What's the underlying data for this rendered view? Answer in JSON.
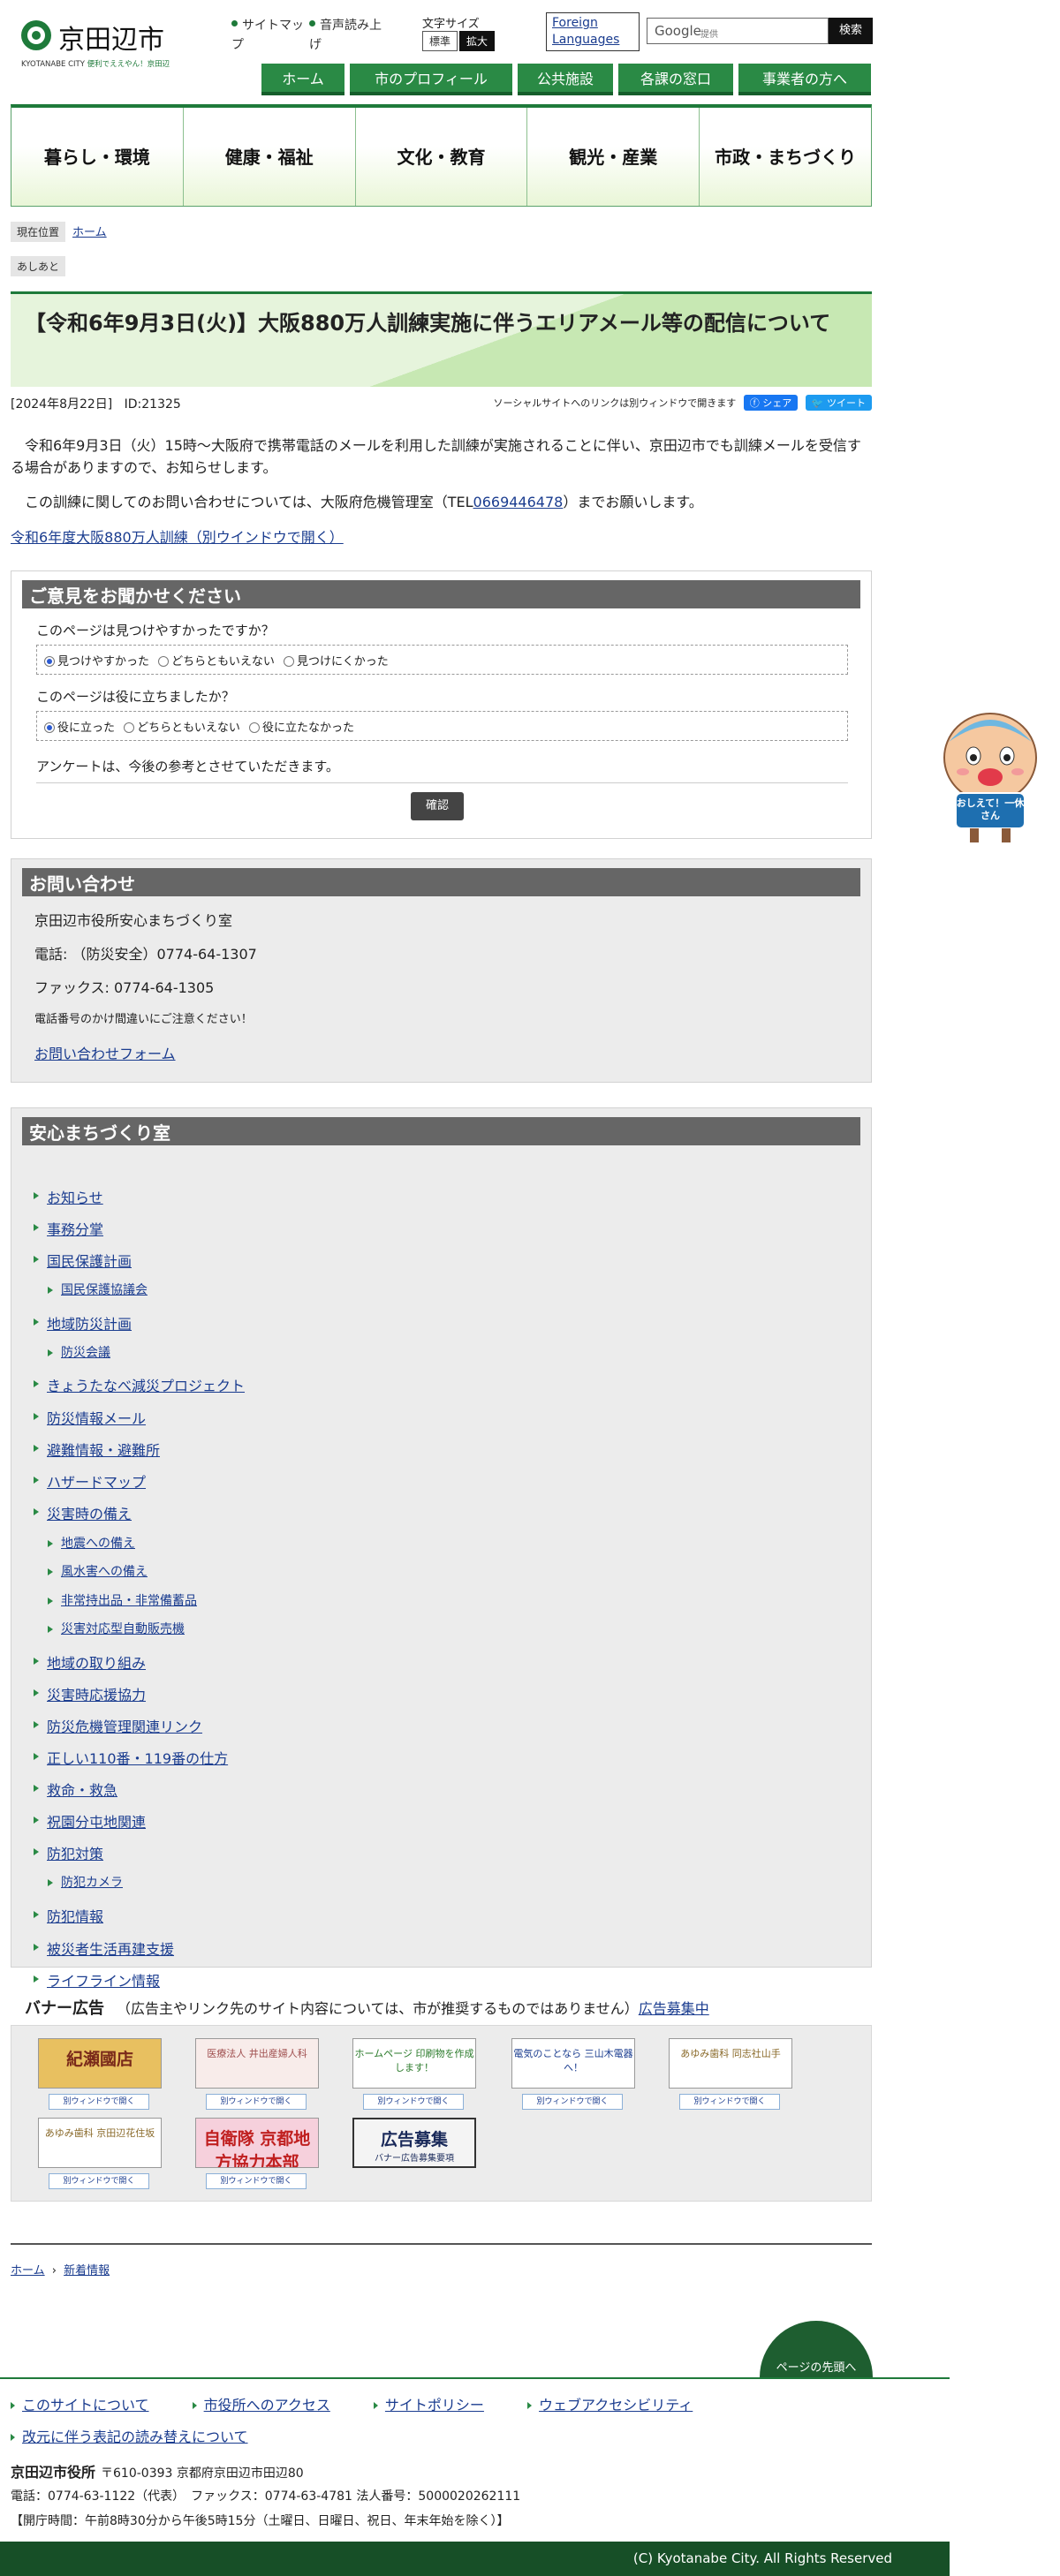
{
  "header": {
    "logo_name": "京田辺市",
    "logo_sub_city": "KYOTANABE CITY",
    "logo_sub_tagline": "便利でええやん！京田辺",
    "sitemap": "サイトマップ",
    "voice": "音声読み上げ",
    "fontsize_label": "文字サイズ",
    "fontsize_std": "標準",
    "fontsize_big": "拡大",
    "foreign": "Foreign Languages",
    "search_brand": "Google",
    "search_provided": "提供",
    "search_button": "検索",
    "subnav": [
      "ホーム",
      "市のプロフィール",
      "公共施設",
      "各課の窓口",
      "事業者の方へ"
    ]
  },
  "gnav": [
    "暮らし・環境",
    "健康・福祉",
    "文化・教育",
    "観光・産業",
    "市政・まちづくり"
  ],
  "breadcrumb": {
    "current_label": "現在位置",
    "home": "ホーム",
    "footprint_label": "あしあと"
  },
  "article": {
    "title": "【令和6年9月3日(火)】大阪880万人訓練実施に伴うエリアメール等の配信について",
    "date": "[2024年8月22日]",
    "id": "ID:21325",
    "social_note": "ソーシャルサイトへのリンクは別ウィンドウで開きます",
    "share": "シェア",
    "tweet": "ツイート",
    "para1": "令和6年9月3日（火）15時～大阪府で携帯電話のメールを利用した訓練が実施されることに伴い、京田辺市でも訓練メールを受信する場合がありますので、お知らせします。",
    "para2_before": "この訓練に関してのお問い合わせについては、大阪府危機管理室（TEL",
    "para2_tel": "0669446478",
    "para2_after": "）までお願いします。",
    "link": "令和6年度大阪880万人訓練（別ウインドウで開く）"
  },
  "survey": {
    "title": "ご意見をお聞かせください",
    "q1": "このページは見つけやすかったですか？",
    "q1_options": [
      "見つけやすかった",
      "どちらともいえない",
      "見つけにくかった"
    ],
    "q2": "このページは役に立ちましたか？",
    "q2_options": [
      "役に立った",
      "どちらともいえない",
      "役に立たなかった"
    ],
    "note": "アンケートは、今後の参考とさせていただきます。",
    "confirm": "確認"
  },
  "contact": {
    "title": "お問い合わせ",
    "dept": "京田辺市役所安心まちづくり室",
    "tel": "電話: （防災安全）0774-64-1307",
    "fax": "ファックス: 0774-64-1305",
    "warning": "電話番号のかけ間違いにご注意ください！",
    "form": "お問い合わせフォーム"
  },
  "section_menu": {
    "title": "安心まちづくり室",
    "items": [
      {
        "label": "お知らせ",
        "sub": false
      },
      {
        "label": "事務分掌",
        "sub": false
      },
      {
        "label": "国民保護計画",
        "sub": false
      },
      {
        "label": "国民保護協議会",
        "sub": true
      },
      {
        "label": "地域防災計画",
        "sub": false
      },
      {
        "label": "防災会議",
        "sub": true
      },
      {
        "label": "きょうたなべ減災プロジェクト",
        "sub": false
      },
      {
        "label": "防災情報メール",
        "sub": false
      },
      {
        "label": "避難情報・避難所",
        "sub": false
      },
      {
        "label": "ハザードマップ",
        "sub": false
      },
      {
        "label": "災害時の備え",
        "sub": false
      },
      {
        "label": "地震への備え",
        "sub": true
      },
      {
        "label": "風水害への備え",
        "sub": true
      },
      {
        "label": "非常持出品・非常備蓄品",
        "sub": true
      },
      {
        "label": "災害対応型自動販売機",
        "sub": true
      },
      {
        "label": "地域の取り組み",
        "sub": false
      },
      {
        "label": "災害時応援協力",
        "sub": false
      },
      {
        "label": "防災危機管理関連リンク",
        "sub": false
      },
      {
        "label": "正しい110番・119番の仕方",
        "sub": false
      },
      {
        "label": "救命・救急",
        "sub": false
      },
      {
        "label": "祝園分屯地関連",
        "sub": false
      },
      {
        "label": "防犯対策",
        "sub": false
      },
      {
        "label": "防犯カメラ",
        "sub": true
      },
      {
        "label": "防犯情報",
        "sub": false
      },
      {
        "label": "被災者生活再建支援",
        "sub": false
      },
      {
        "label": "ライフライン情報",
        "sub": false
      }
    ]
  },
  "banners": {
    "title": "バナー広告",
    "note": "（広告主やリンク先のサイト内容については、市が推奨するものではありません）",
    "recruit": "広告募集中",
    "new_window": "別ウィンドウで開く",
    "items": [
      {
        "text": "紀瀬國店",
        "color": "#7a2a1a",
        "bg": "#e8c060"
      },
      {
        "text": "医療法人 井出産婦人科",
        "color": "#a05050",
        "bg": "#f8ecea"
      },
      {
        "text": "ホームページ 印刷物を作成します！",
        "color": "#2a7a2a",
        "bg": "#ffffff"
      },
      {
        "text": "電気のことなら 三山木電器へ！",
        "color": "#1a3c8f",
        "bg": "#ffffff"
      },
      {
        "text": "あゆみ歯科 同志社山手",
        "color": "#8a6a2a",
        "bg": "#ffffff"
      },
      {
        "text": "あゆみ歯科 京田辺花住坂",
        "color": "#8a6a2a",
        "bg": "#ffffff"
      },
      {
        "text": "自衛隊 京都地方協力本部",
        "color": "#c02020",
        "bg": "#f6d0dc"
      },
      {
        "text": "広告募集",
        "color": "#1a2a5a",
        "bg": "#f4f4f4"
      }
    ],
    "recruit_sub": "バナー広告募集要項"
  },
  "bottom_crumb": {
    "home": "ホーム",
    "news": "新着情報"
  },
  "footer": {
    "pagetop": "ページの先頭へ",
    "links": [
      "このサイトについて",
      "市役所へのアクセス",
      "サイトポリシー",
      "ウェブアクセシビリティ"
    ],
    "link2": "改元に伴う表記の読み替えについて",
    "org": "京田辺市役所",
    "address": "〒610-0393 京都府京田辺市田辺80",
    "phone": "電話：0774-63-1122（代表）　ファックス：0774-63-4781 法人番号：5000020262111",
    "hours": "【開庁時間：午前8時30分から午後5時15分（土曜日、日曜日、祝日、年末年始を除く）】",
    "copyright": "(C) Kyotanabe City. All Rights Reserved"
  },
  "mascot": {
    "text": "おしえて！一休さん"
  },
  "colors": {
    "brand_green": "#1e7a3a",
    "header_gray": "#666666",
    "link": "#1a3c8f"
  }
}
